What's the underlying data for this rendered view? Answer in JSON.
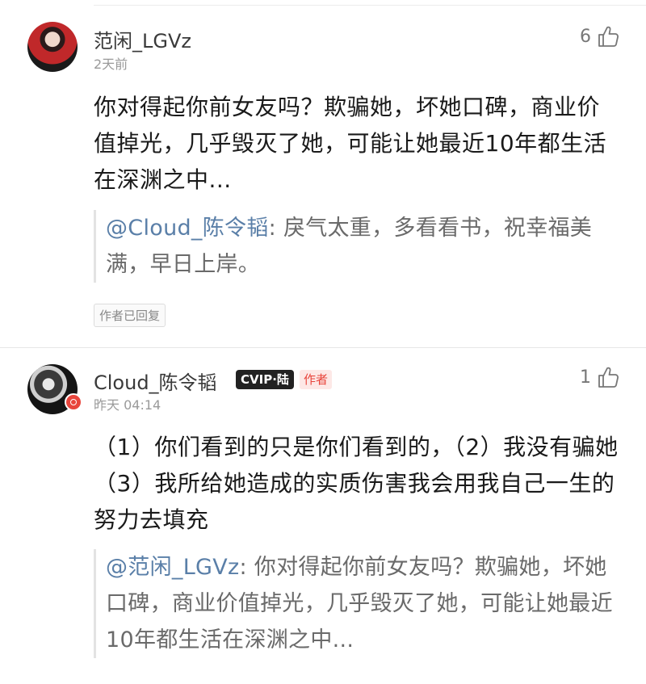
{
  "comments": [
    {
      "username": "范闲_LGVz",
      "timestamp": "2天前",
      "likes": "6",
      "body": "你对得起你前女友吗？欺骗她，坏她口碑，商业价值掉光，几乎毁灭了她，可能让她最近10年都生活在深渊之中...",
      "quote_name": "@Cloud_陈令韬",
      "quote_text": ": 戾气太重，多看看书，祝幸福美满，早日上岸。",
      "tag": "作者已回复"
    },
    {
      "username": "Cloud_陈令韬",
      "vip_badge": "CVIP·陆",
      "author_badge": "作者",
      "timestamp": "昨天 04:14",
      "likes": "1",
      "body": "（1）你们看到的只是你们看到的，（2）我没有骗她（3）我所给她造成的实质伤害我会用我自己一生的努力去填充",
      "quote_name": "@范闲_LGVz",
      "quote_text": ": 你对得起你前女友吗？欺骗她，坏她口碑，商业价值掉光，几乎毁灭了她，可能让她最近10年都生活在深渊之中..."
    }
  ],
  "icons": {
    "like": "thumbs-up-icon",
    "vip": "vip-circle-icon"
  },
  "colors": {
    "quote_name": "#5a7fa8",
    "author_badge": "#e8453c",
    "vip_dot": "#e8453c"
  }
}
